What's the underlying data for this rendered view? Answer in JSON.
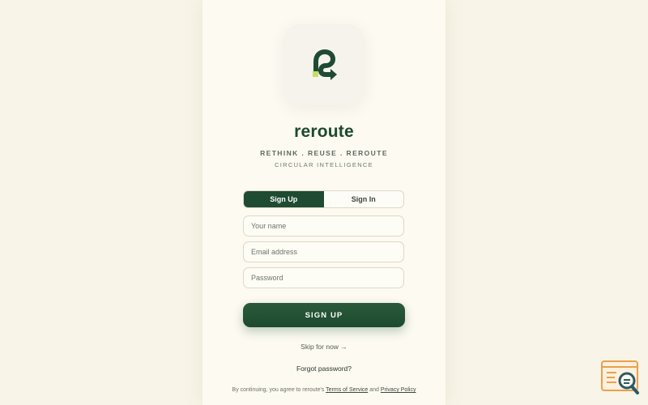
{
  "brand": {
    "name": "reroute",
    "tagline": "RETHINK . REUSE . REROUTE",
    "subtitle": "CIRCULAR INTELLIGENCE",
    "logo_icon": "reroute-arrow-logo-icon"
  },
  "auth_tabs": {
    "signup_label": "Sign Up",
    "signin_label": "Sign In",
    "active": "Sign Up"
  },
  "form": {
    "name_placeholder": "Your name",
    "name_value": "",
    "email_placeholder": "Email address",
    "email_value": "",
    "password_placeholder": "Password",
    "password_value": "",
    "submit_label": "SIGN UP"
  },
  "links": {
    "skip_label": "Skip for now →",
    "forgot_label": "Forgot password?"
  },
  "legal": {
    "prefix": "By continuing, you agree to reroute's",
    "terms_label": "Terms of Service",
    "and": "and",
    "privacy_label": "Privacy Policy"
  },
  "colors": {
    "page_background": "#f8f4e7",
    "brand_green": "#1e4b31",
    "accent_lime": "#c6dd6b",
    "helper_orange": "#e8a04e",
    "helper_teal": "#2a5b67"
  },
  "helper_widget": {
    "icon": "search-assistant-icon"
  }
}
